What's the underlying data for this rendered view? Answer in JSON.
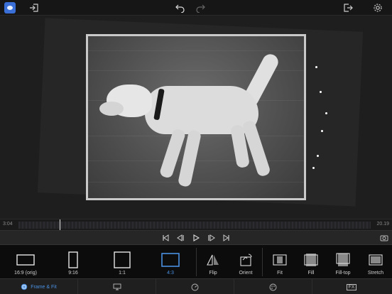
{
  "colors": {
    "accent": "#4a90e2",
    "background": "#1c1c1c",
    "toolbar": "#0c0c0c"
  },
  "topbar": {
    "icons": [
      "app-icon",
      "import-icon",
      "undo-icon",
      "redo-icon",
      "export-icon",
      "settings-icon"
    ]
  },
  "timeline": {
    "time_start": "3:04",
    "time_end": "20.19",
    "playhead_fraction": 0.15
  },
  "transport": {
    "icons": [
      "skip-start-icon",
      "step-back-icon",
      "play-icon",
      "step-forward-icon",
      "skip-end-icon",
      "snapshot-icon"
    ]
  },
  "options": {
    "items": [
      {
        "label": "16:9 (orig)",
        "icon": "aspect-16-9-icon"
      },
      {
        "label": "9:16",
        "icon": "aspect-9-16-icon"
      },
      {
        "label": "1:1",
        "icon": "aspect-1-1-icon"
      },
      {
        "label": "4:3",
        "icon": "aspect-4-3-icon",
        "selected": true
      },
      {
        "label": "Flip",
        "icon": "flip-icon"
      },
      {
        "label": "Orient",
        "icon": "orient-icon"
      },
      {
        "label": "Fit",
        "icon": "fit-icon"
      },
      {
        "label": "Fill",
        "icon": "fill-icon"
      },
      {
        "label": "Fill-top",
        "icon": "fill-top-icon"
      },
      {
        "label": "Stretch",
        "icon": "stretch-icon"
      }
    ]
  },
  "tabs": [
    {
      "label": "Frame & Fit",
      "icon": "frame-fit-icon",
      "active": true
    },
    {
      "label": "",
      "icon": "presentation-icon"
    },
    {
      "label": "",
      "icon": "speed-icon"
    },
    {
      "label": "",
      "icon": "palette-icon"
    },
    {
      "label": "FX",
      "icon": "fx-icon"
    }
  ]
}
